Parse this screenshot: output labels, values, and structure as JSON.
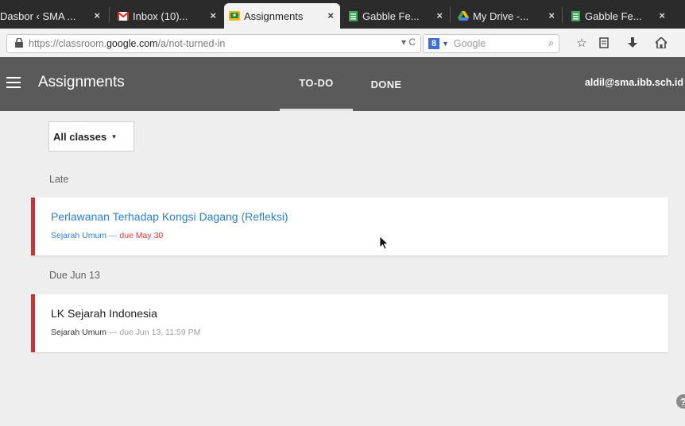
{
  "browser": {
    "tabs": [
      {
        "label": "Dasbor ‹ SMA ...",
        "icon": "wordpress-icon",
        "active": false
      },
      {
        "label": "Inbox (10)...",
        "icon": "gmail-icon",
        "active": false
      },
      {
        "label": "Assignments",
        "icon": "classroom-icon",
        "active": true
      },
      {
        "label": "Gabble Fe...",
        "icon": "sheets-icon",
        "active": false
      },
      {
        "label": "My Drive -...",
        "icon": "drive-icon",
        "active": false
      },
      {
        "label": "Gabble Fe...",
        "icon": "sheets-icon",
        "active": false
      }
    ],
    "close_glyph": "×",
    "url_prefix": "https://classroom.",
    "url_host": "google.com",
    "url_path": "/a/not-turned-in",
    "url_controls": "▾ C",
    "search_engine_badge": "8",
    "search_placeholder": "Google",
    "search_icon_glyph": "⌕",
    "nav_icons": [
      "star-icon",
      "bookmarks-icon",
      "download-icon",
      "home-icon"
    ]
  },
  "app": {
    "title": "Assignments",
    "tabs": [
      {
        "label": "TO-DO",
        "active": true
      },
      {
        "label": "DONE",
        "active": false
      }
    ],
    "account": "aldil@sma.ibb.sch.id"
  },
  "filter": {
    "label": "All classes",
    "caret": "▾"
  },
  "sections": [
    {
      "label": "Late",
      "assignment": {
        "title": "Perlawanan Terhadap Kongsi Dagang (Refleksi)",
        "course": "Sejarah Umum",
        "separator": "—",
        "due": "due May 30",
        "status": "late"
      }
    },
    {
      "label": "Due Jun 13",
      "assignment": {
        "title": "LK Sejarah Indonesia",
        "course": "Sejarah Umum",
        "separator": "—",
        "due": "due Jun 13, 11:59 PM",
        "status": "upcoming"
      }
    }
  ],
  "colors": {
    "app_bar": "#5a5a5a",
    "late_accent": "#d32f2f",
    "link_blue": "#2b7fd4",
    "late_due": "#e53935"
  },
  "help": {
    "icon": "help-icon",
    "glyph": "?"
  }
}
